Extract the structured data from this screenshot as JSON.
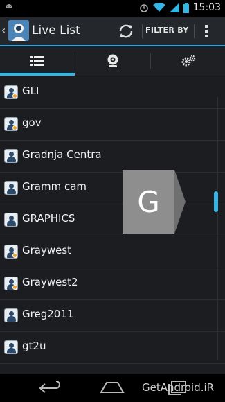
{
  "status_bar": {
    "time": "15:03",
    "icons": [
      "android-icon",
      "alarm-icon",
      "wifi-icon",
      "signal-icon",
      "battery-icon"
    ]
  },
  "action_bar": {
    "title": "Live List",
    "filter_label": "FILTER BY",
    "icons": [
      "back-chevron-icon",
      "app-logo-icon",
      "refresh-icon",
      "overflow-menu-icon"
    ]
  },
  "tabs": [
    {
      "name": "list",
      "icon": "list-icon",
      "selected": true
    },
    {
      "name": "camera",
      "icon": "webcam-icon",
      "selected": false
    },
    {
      "name": "settings",
      "icon": "gears-icon",
      "selected": false
    }
  ],
  "list": {
    "items": [
      {
        "label": "GLI",
        "badge": true
      },
      {
        "label": "gov",
        "badge": true
      },
      {
        "label": "Gradnja Centra",
        "badge": false
      },
      {
        "label": "Gramm cam",
        "badge": false
      },
      {
        "label": "GRAPHICS",
        "badge": false
      },
      {
        "label": "Graywest",
        "badge": true
      },
      {
        "label": "Graywest2",
        "badge": true
      },
      {
        "label": "Greg2011",
        "badge": false
      },
      {
        "label": "gt2u",
        "badge": false
      }
    ]
  },
  "fast_scroll": {
    "letter": "G"
  },
  "navigation": {
    "icons": [
      "back-icon",
      "home-icon",
      "recents-icon"
    ]
  },
  "watermark": "GetAndroid.iR",
  "colors": {
    "accent": "#33b5e5",
    "badge": "#f0a020",
    "background": "#1b1d21"
  }
}
